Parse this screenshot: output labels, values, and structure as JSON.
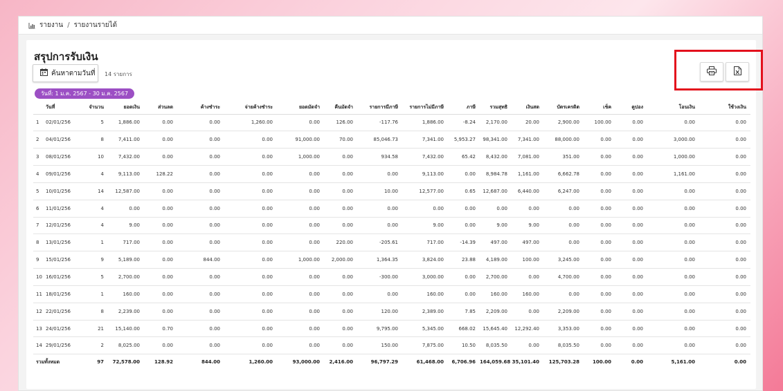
{
  "breadcrumb": {
    "root": "รายงาน",
    "separator": "/",
    "current": "รายงานรายได้"
  },
  "page": {
    "title": "สรุปการรับเงิน",
    "search_label": "ค้นหาตามวันที่",
    "count_text": "14 รายการ",
    "date_range": "วันที่: 1 ม.ค. 2567 - 30 ม.ค. 2567"
  },
  "toolbar": {
    "print_icon": "printer-icon",
    "excel_icon": "excel-export-icon",
    "highlight_color": "#e3101c"
  },
  "colors": {
    "chip": "#9c4fc4"
  },
  "table": {
    "headers": [
      "วันที่",
      "จำนวน",
      "ยอดเงิน",
      "ส่วนลด",
      "ค้างชำระ",
      "จ่ายค้างชำระ",
      "ยอดมัดจำ",
      "คืนมัดจำ",
      "รายการมีภาษี",
      "รายการไม่มีภาษี",
      "ภาษี",
      "รวมสุทธิ",
      "เงินสด",
      "บัตรเครดิต",
      "เช็ค",
      "คูปอง",
      "โอนเงิน",
      "ใช้วงเงิน"
    ],
    "rows": [
      [
        "1",
        "02/01/2567",
        "5",
        "1,886.00",
        "0.00",
        "0.00",
        "1,260.00",
        "0.00",
        "126.00",
        "-117.76",
        "1,886.00",
        "-8.24",
        "2,170.00",
        "20.00",
        "2,900.00",
        "100.00",
        "0.00",
        "0.00",
        "0.00"
      ],
      [
        "2",
        "04/01/2567",
        "8",
        "7,411.00",
        "0.00",
        "0.00",
        "0.00",
        "91,000.00",
        "70.00",
        "85,046.73",
        "7,341.00",
        "5,953.27",
        "98,341.00",
        "7,341.00",
        "88,000.00",
        "0.00",
        "0.00",
        "3,000.00",
        "0.00"
      ],
      [
        "3",
        "08/01/2567",
        "10",
        "7,432.00",
        "0.00",
        "0.00",
        "0.00",
        "1,000.00",
        "0.00",
        "934.58",
        "7,432.00",
        "65.42",
        "8,432.00",
        "7,081.00",
        "351.00",
        "0.00",
        "0.00",
        "1,000.00",
        "0.00"
      ],
      [
        "4",
        "09/01/2567",
        "4",
        "9,113.00",
        "128.22",
        "0.00",
        "0.00",
        "0.00",
        "0.00",
        "0.00",
        "9,113.00",
        "0.00",
        "8,984.78",
        "1,161.00",
        "6,662.78",
        "0.00",
        "0.00",
        "1,161.00",
        "0.00"
      ],
      [
        "5",
        "10/01/2567",
        "14",
        "12,587.00",
        "0.00",
        "0.00",
        "0.00",
        "0.00",
        "0.00",
        "10.00",
        "12,577.00",
        "0.65",
        "12,687.00",
        "6,440.00",
        "6,247.00",
        "0.00",
        "0.00",
        "0.00",
        "0.00"
      ],
      [
        "6",
        "11/01/2567",
        "4",
        "0.00",
        "0.00",
        "0.00",
        "0.00",
        "0.00",
        "0.00",
        "0.00",
        "0.00",
        "0.00",
        "0.00",
        "0.00",
        "0.00",
        "0.00",
        "0.00",
        "0.00",
        "0.00"
      ],
      [
        "7",
        "12/01/2567",
        "4",
        "9.00",
        "0.00",
        "0.00",
        "0.00",
        "0.00",
        "0.00",
        "0.00",
        "9.00",
        "0.00",
        "9.00",
        "9.00",
        "0.00",
        "0.00",
        "0.00",
        "0.00",
        "0.00"
      ],
      [
        "8",
        "13/01/2567",
        "1",
        "717.00",
        "0.00",
        "0.00",
        "0.00",
        "0.00",
        "220.00",
        "-205.61",
        "717.00",
        "-14.39",
        "497.00",
        "497.00",
        "0.00",
        "0.00",
        "0.00",
        "0.00",
        "0.00"
      ],
      [
        "9",
        "15/01/2567",
        "9",
        "5,189.00",
        "0.00",
        "844.00",
        "0.00",
        "1,000.00",
        "2,000.00",
        "1,364.35",
        "3,824.00",
        "23.88",
        "4,189.00",
        "100.00",
        "3,245.00",
        "0.00",
        "0.00",
        "0.00",
        "0.00"
      ],
      [
        "10",
        "16/01/2567",
        "5",
        "2,700.00",
        "0.00",
        "0.00",
        "0.00",
        "0.00",
        "0.00",
        "-300.00",
        "3,000.00",
        "0.00",
        "2,700.00",
        "0.00",
        "4,700.00",
        "0.00",
        "0.00",
        "0.00",
        "0.00"
      ],
      [
        "11",
        "18/01/2567",
        "1",
        "160.00",
        "0.00",
        "0.00",
        "0.00",
        "0.00",
        "0.00",
        "0.00",
        "160.00",
        "0.00",
        "160.00",
        "160.00",
        "0.00",
        "0.00",
        "0.00",
        "0.00",
        "0.00"
      ],
      [
        "12",
        "22/01/2567",
        "8",
        "2,239.00",
        "0.00",
        "0.00",
        "0.00",
        "0.00",
        "0.00",
        "120.00",
        "2,389.00",
        "7.85",
        "2,209.00",
        "0.00",
        "2,209.00",
        "0.00",
        "0.00",
        "0.00",
        "0.00"
      ],
      [
        "13",
        "24/01/2567",
        "21",
        "15,140.00",
        "0.70",
        "0.00",
        "0.00",
        "0.00",
        "0.00",
        "9,795.00",
        "5,345.00",
        "668.02",
        "15,645.40",
        "12,292.40",
        "3,353.00",
        "0.00",
        "0.00",
        "0.00",
        "0.00"
      ],
      [
        "14",
        "29/01/2567",
        "2",
        "8,025.00",
        "0.00",
        "0.00",
        "0.00",
        "0.00",
        "0.00",
        "150.00",
        "7,875.00",
        "10.50",
        "8,035.50",
        "0.00",
        "8,035.50",
        "0.00",
        "0.00",
        "0.00",
        "0.00"
      ]
    ],
    "total": [
      "รวมทั้งหมด",
      "97",
      "72,578.00",
      "128.92",
      "844.00",
      "1,260.00",
      "93,000.00",
      "2,416.00",
      "96,797.29",
      "61,468.00",
      "6,706.96",
      "164,059.68",
      "35,101.40",
      "125,703.28",
      "100.00",
      "0.00",
      "5,161.00",
      "0.00"
    ]
  }
}
